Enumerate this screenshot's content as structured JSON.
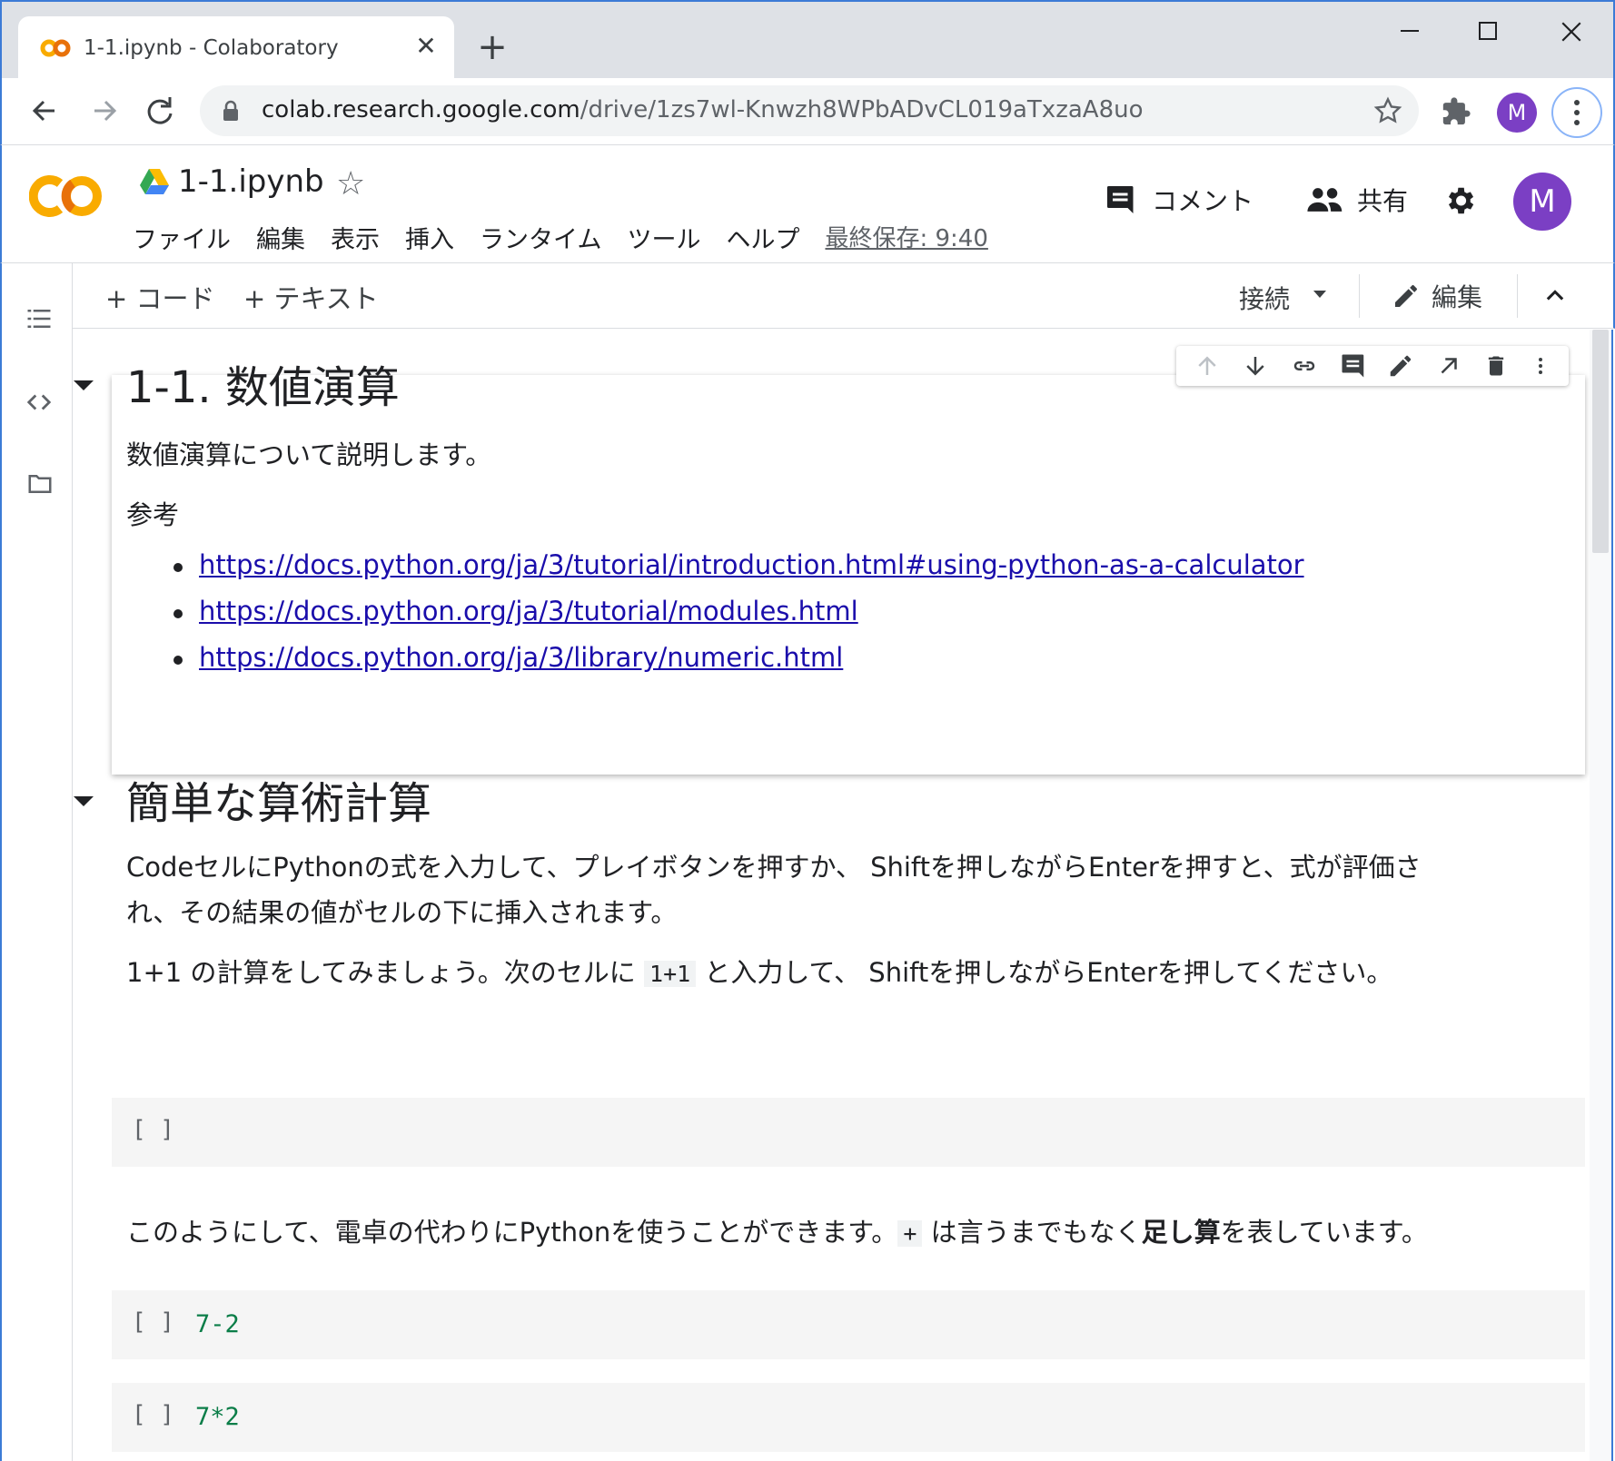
{
  "browser": {
    "tab_title": "1-1.ipynb - Colaboratory",
    "url_host": "colab.research.google.com",
    "url_path": "/drive/1zs7wl-Knwzh8WPbADvCL019aTxzaA8uo",
    "profile_initial": "M"
  },
  "header": {
    "notebook_title": "1-1.ipynb",
    "menu": [
      "ファイル",
      "編集",
      "表示",
      "挿入",
      "ランタイム",
      "ツール",
      "ヘルプ"
    ],
    "last_saved": "最終保存: 9:40",
    "comment_label": "コメント",
    "share_label": "共有",
    "avatar_initial": "M"
  },
  "toolbar": {
    "add_code": "+ コード",
    "add_text": "+ テキスト",
    "connect": "接続",
    "edit": "編集"
  },
  "cells": {
    "intro": {
      "heading": "1-1. 数値演算",
      "description": "数値演算について説明します。",
      "reference_label": "参考",
      "links": [
        "https://docs.python.org/ja/3/tutorial/introduction.html#using-python-as-a-calculator",
        "https://docs.python.org/ja/3/tutorial/modules.html",
        "https://docs.python.org/ja/3/library/numeric.html"
      ]
    },
    "arith": {
      "heading": "簡単な算術計算",
      "para1_line1": "CodeセルにPythonの式を入力して、プレイボタンを押すか、 Shiftを押しながらEnterを押すと、式が評価さ",
      "para1_line2": "れ、その結果の値がセルの下に挿入されます。",
      "para2_before": "1+1 の計算をしてみましょう。次のセルに ",
      "para2_code": "1+1",
      "para2_after": " と入力して、 Shiftを押しながらEnterを押してください。",
      "para3_before": "このようにして、電卓の代わりにPythonを使うことができます。",
      "para3_code": "+",
      "para3_mid": " は言うまでもなく",
      "para3_bold": "足し算",
      "para3_after": "を表しています。"
    },
    "code_cells": [
      {
        "bracket": "[ ]",
        "code": ""
      },
      {
        "bracket": "[ ]",
        "code": "7-2"
      },
      {
        "bracket": "[ ]",
        "code": "7*2"
      }
    ]
  }
}
